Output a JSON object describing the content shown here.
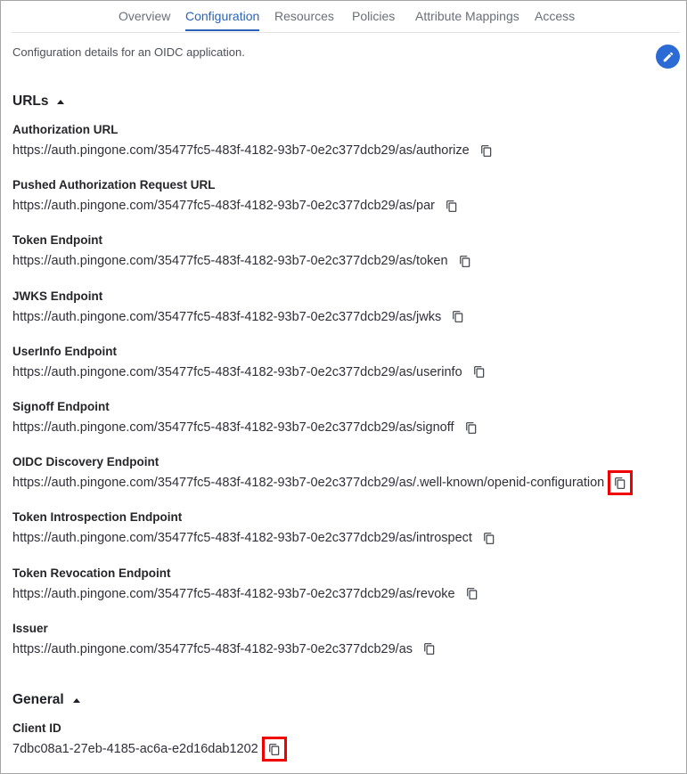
{
  "tabs": [
    {
      "label": "Overview"
    },
    {
      "label": "Configuration",
      "active": true
    },
    {
      "label": "Resources"
    },
    {
      "label": "Policies"
    },
    {
      "label": "Attribute Mappings"
    },
    {
      "label": "Access"
    }
  ],
  "description": "Configuration details for an OIDC application.",
  "edit_icon": "pencil-icon",
  "urls_section": {
    "title": "URLs",
    "fields": [
      {
        "label": "Authorization URL",
        "value": "https://auth.pingone.com/35477fc5-483f-4182-93b7-0e2c377dcb29/as/authorize"
      },
      {
        "label": "Pushed Authorization Request URL",
        "value": "https://auth.pingone.com/35477fc5-483f-4182-93b7-0e2c377dcb29/as/par"
      },
      {
        "label": "Token Endpoint",
        "value": "https://auth.pingone.com/35477fc5-483f-4182-93b7-0e2c377dcb29/as/token"
      },
      {
        "label": "JWKS Endpoint",
        "value": "https://auth.pingone.com/35477fc5-483f-4182-93b7-0e2c377dcb29/as/jwks"
      },
      {
        "label": "UserInfo Endpoint",
        "value": "https://auth.pingone.com/35477fc5-483f-4182-93b7-0e2c377dcb29/as/userinfo"
      },
      {
        "label": "Signoff Endpoint",
        "value": "https://auth.pingone.com/35477fc5-483f-4182-93b7-0e2c377dcb29/as/signoff"
      },
      {
        "label": "OIDC Discovery Endpoint",
        "value": "https://auth.pingone.com/35477fc5-483f-4182-93b7-0e2c377dcb29/as/.well-known/openid-configuration"
      },
      {
        "label": "Token Introspection Endpoint",
        "value": "https://auth.pingone.com/35477fc5-483f-4182-93b7-0e2c377dcb29/as/introspect"
      },
      {
        "label": "Token Revocation Endpoint",
        "value": "https://auth.pingone.com/35477fc5-483f-4182-93b7-0e2c377dcb29/as/revoke"
      },
      {
        "label": "Issuer",
        "value": "https://auth.pingone.com/35477fc5-483f-4182-93b7-0e2c377dcb29/as"
      }
    ]
  },
  "general_section": {
    "title": "General",
    "fields": [
      {
        "label": "Client ID",
        "value": "7dbc08a1-27eb-4185-ac6a-e2d16dab1202"
      }
    ]
  },
  "colors": {
    "accent": "#2b63b7",
    "edit_button": "#2c6bd6",
    "highlight": "#f00000"
  }
}
